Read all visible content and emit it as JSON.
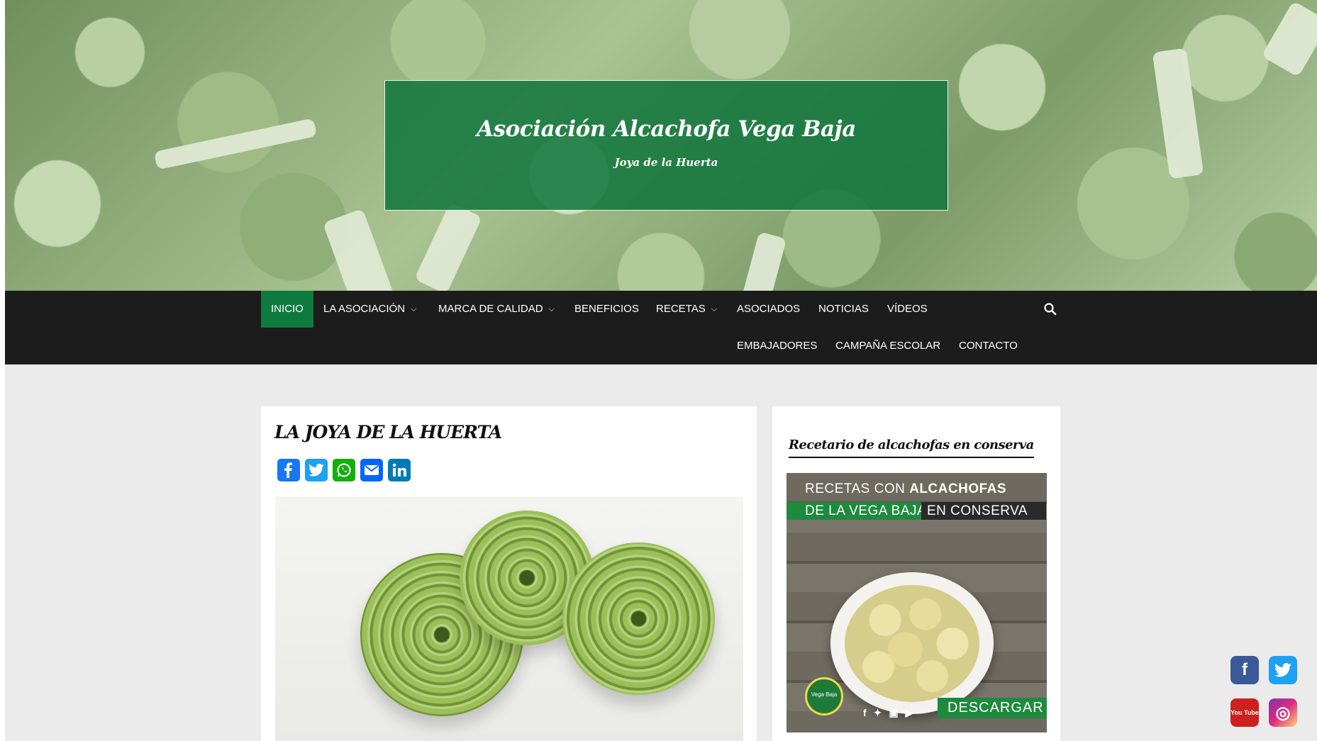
{
  "header": {
    "site_title": "Asociación Alcachofa Vega Baja",
    "tagline": "Joya de la Huerta"
  },
  "nav": {
    "items_row1": [
      {
        "label": "INICIO",
        "active": true,
        "has_dropdown": false
      },
      {
        "label": "LA ASOCIACIÓN",
        "active": false,
        "has_dropdown": true
      },
      {
        "label": "MARCA DE CALIDAD",
        "active": false,
        "has_dropdown": true
      },
      {
        "label": "BENEFICIOS",
        "active": false,
        "has_dropdown": false
      },
      {
        "label": "RECETAS",
        "active": false,
        "has_dropdown": true
      },
      {
        "label": "ASOCIADOS",
        "active": false,
        "has_dropdown": false
      },
      {
        "label": "NOTICIAS",
        "active": false,
        "has_dropdown": false
      },
      {
        "label": "VÍDEOS",
        "active": false,
        "has_dropdown": false
      }
    ],
    "items_row2": [
      {
        "label": "EMBAJADORES"
      },
      {
        "label": "CAMPAÑA ESCOLAR"
      },
      {
        "label": "CONTACTO"
      }
    ],
    "search_icon": "search-icon"
  },
  "post": {
    "title": "LA JOYA DE LA HUERTA",
    "share_buttons": [
      {
        "name": "facebook-icon",
        "color": "#1877f2"
      },
      {
        "name": "twitter-icon",
        "color": "#1da1f2"
      },
      {
        "name": "whatsapp-icon",
        "color": "#12af0a"
      },
      {
        "name": "email-icon",
        "color": "#0166ff"
      },
      {
        "name": "linkedin-icon",
        "color": "#007bb5"
      }
    ]
  },
  "sidebar": {
    "widget_title": "Recetario de alcachofas en conserva",
    "promo": {
      "line1_a": "RECETAS CON ",
      "line1_b": "ALCACHOFAS",
      "line2_a": "DE LA VEGA BAJA",
      "line2_b": "EN CONSERVA",
      "logo_text": "Vega Baja",
      "download": "DESCARGAR"
    }
  },
  "floating_social": [
    {
      "name": "facebook-icon",
      "color": "#3b5998",
      "glyph": "f"
    },
    {
      "name": "twitter-icon",
      "color": "#1da1f2",
      "glyph": "t"
    },
    {
      "name": "youtube-icon",
      "color": "#cd201f",
      "glyph": "You Tube"
    },
    {
      "name": "instagram-icon",
      "color": "#c13584",
      "glyph": "◎"
    }
  ],
  "colors": {
    "brand_green": "#0f7a3d",
    "nav_bg": "#1c1c1c",
    "content_bg": "#ebebeb"
  }
}
